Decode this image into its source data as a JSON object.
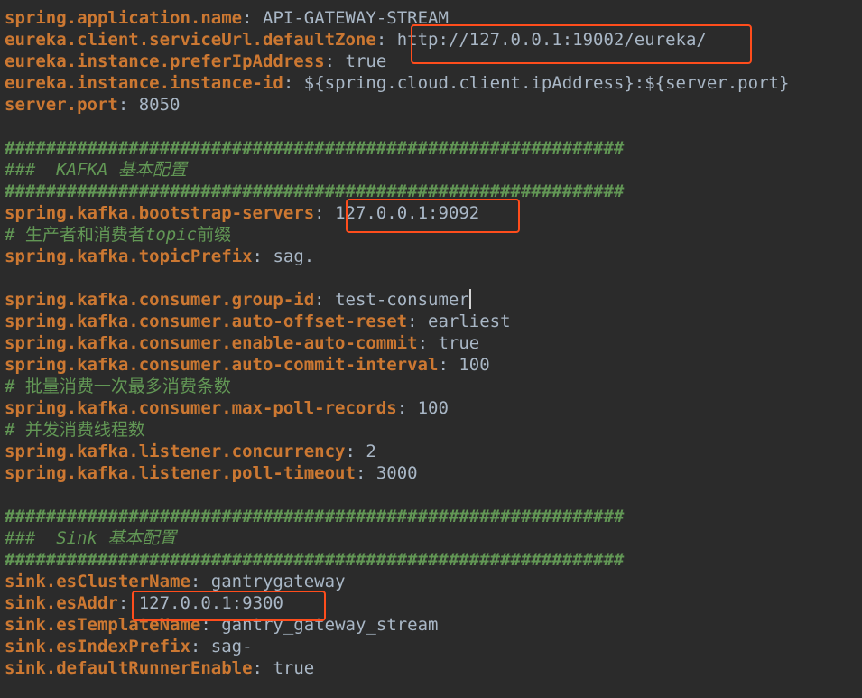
{
  "editor": {
    "lines": [
      {
        "kind": "prop",
        "key": "spring.application.name",
        "sep": ": ",
        "value": "API-GATEWAY-STREAM"
      },
      {
        "kind": "prop",
        "key": "eureka.client.serviceUrl.defaultZone",
        "sep": ": ",
        "value": "http://127.0.0.1:19002/eureka/",
        "highlighted": true
      },
      {
        "kind": "prop",
        "key": "eureka.instance.preferIpAddress",
        "sep": ": ",
        "value": "true"
      },
      {
        "kind": "prop",
        "key": "eureka.instance.instance-id",
        "sep": ": ",
        "value": "${spring.cloud.client.ipAddress}:${server.port}"
      },
      {
        "kind": "prop",
        "key": "server.port",
        "sep": ": ",
        "value": "8050"
      },
      {
        "kind": "blank"
      },
      {
        "kind": "hashes",
        "text": "############################################################"
      },
      {
        "kind": "section",
        "text": "###  KAFKA 基本配置"
      },
      {
        "kind": "hashes",
        "text": "############################################################"
      },
      {
        "kind": "prop",
        "key": "spring.kafka.bootstrap-servers",
        "sep": ": ",
        "value": "127.0.0.1:9092",
        "highlighted": true
      },
      {
        "kind": "comment",
        "prefix": "# 生产者和消费者",
        "italic": "topic",
        "suffix": "前缀"
      },
      {
        "kind": "prop",
        "key": "spring.kafka.topicPrefix",
        "sep": ": ",
        "value": "sag."
      },
      {
        "kind": "blank"
      },
      {
        "kind": "prop",
        "key": "spring.kafka.consumer.group-id",
        "sep": ": ",
        "value": "test-consumer",
        "cursor": true
      },
      {
        "kind": "prop",
        "key": "spring.kafka.consumer.auto-offset-reset",
        "sep": ": ",
        "value": "earliest"
      },
      {
        "kind": "prop",
        "key": "spring.kafka.consumer.enable-auto-commit",
        "sep": ": ",
        "value": "true"
      },
      {
        "kind": "prop",
        "key": "spring.kafka.consumer.auto-commit-interval",
        "sep": ": ",
        "value": "100"
      },
      {
        "kind": "comment",
        "prefix": "# 批量消费一次最多消费条数"
      },
      {
        "kind": "prop",
        "key": "spring.kafka.consumer.max-poll-records",
        "sep": ": ",
        "value": "100"
      },
      {
        "kind": "comment",
        "prefix": "# 并发消费线程数"
      },
      {
        "kind": "prop",
        "key": "spring.kafka.listener.concurrency",
        "sep": ": ",
        "value": "2"
      },
      {
        "kind": "prop",
        "key": "spring.kafka.listener.poll-timeout",
        "sep": ": ",
        "value": "3000"
      },
      {
        "kind": "blank"
      },
      {
        "kind": "hashes",
        "text": "############################################################"
      },
      {
        "kind": "section",
        "text": "###  Sink 基本配置"
      },
      {
        "kind": "hashes",
        "text": "############################################################"
      },
      {
        "kind": "prop",
        "key": "sink.esClusterName",
        "sep": ": ",
        "value": "gantrygateway"
      },
      {
        "kind": "prop",
        "key": "sink.esAddr",
        "sep": ": ",
        "value": "127.0.0.1:9300",
        "highlighted": true
      },
      {
        "kind": "prop",
        "key": "sink.esTemplateName",
        "sep": ": ",
        "value": "gantry_gateway_stream"
      },
      {
        "kind": "prop",
        "key": "sink.esIndexPrefix",
        "sep": ": ",
        "value": "sag-"
      },
      {
        "kind": "prop",
        "key": "sink.defaultRunnerEnable",
        "sep": ": ",
        "value": "true"
      }
    ]
  },
  "colors": {
    "background": "#2b2b2b",
    "key": "#cc7832",
    "value": "#a9b7c6",
    "comment": "#629755",
    "highlight_box": "#ff4d1c"
  }
}
